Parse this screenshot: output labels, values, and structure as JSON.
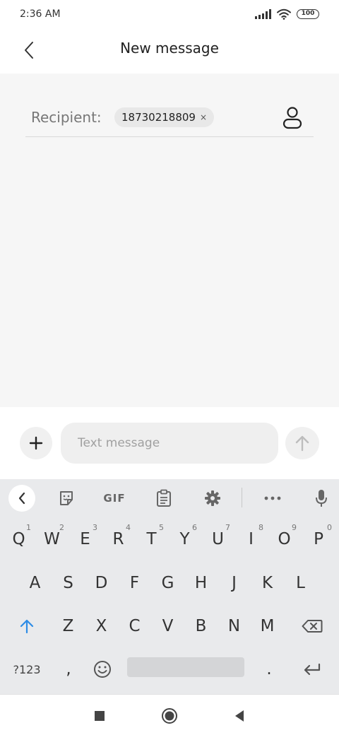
{
  "status_bar": {
    "time": "2:36 AM",
    "battery": "100",
    "icons": [
      "signal-icon",
      "wifi-icon",
      "battery-icon"
    ]
  },
  "header": {
    "title": "New message",
    "back_icon": "chevron-left-icon"
  },
  "recipient": {
    "label": "Recipient:",
    "chips": [
      {
        "value": "18730218809",
        "remove_glyph": "×"
      }
    ],
    "contacts_icon": "person-icon"
  },
  "composer": {
    "placeholder": "Text message",
    "value": "",
    "add_icon": "plus-icon",
    "send_icon": "arrow-up-icon"
  },
  "keyboard": {
    "toolbar": {
      "gif_label": "GIF",
      "icons": [
        "chevron-left-icon",
        "sticker-icon",
        "clipboard-icon",
        "gear-icon",
        "more-icon",
        "mic-icon"
      ]
    },
    "rows": [
      [
        {
          "k": "Q",
          "h": "1"
        },
        {
          "k": "W",
          "h": "2"
        },
        {
          "k": "E",
          "h": "3"
        },
        {
          "k": "R",
          "h": "4"
        },
        {
          "k": "T",
          "h": "5"
        },
        {
          "k": "Y",
          "h": "6"
        },
        {
          "k": "U",
          "h": "7"
        },
        {
          "k": "I",
          "h": "8"
        },
        {
          "k": "O",
          "h": "9"
        },
        {
          "k": "P",
          "h": "0"
        }
      ],
      [
        {
          "k": "A"
        },
        {
          "k": "S"
        },
        {
          "k": "D"
        },
        {
          "k": "F"
        },
        {
          "k": "G"
        },
        {
          "k": "H"
        },
        {
          "k": "J"
        },
        {
          "k": "K"
        },
        {
          "k": "L"
        }
      ],
      [
        {
          "k": "Z"
        },
        {
          "k": "X"
        },
        {
          "k": "C"
        },
        {
          "k": "V"
        },
        {
          "k": "B"
        },
        {
          "k": "N"
        },
        {
          "k": "M"
        }
      ]
    ],
    "bottom_row": {
      "symbols": "?123",
      "comma": ",",
      "period": "."
    }
  },
  "accent_color": "#2d8ce6",
  "nav_bar": {
    "icons": [
      "recents-square-icon",
      "home-circle-icon",
      "back-triangle-icon"
    ]
  }
}
